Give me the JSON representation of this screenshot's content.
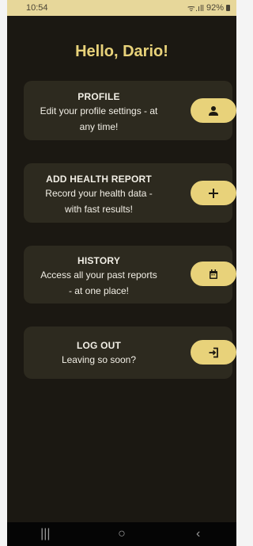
{
  "status_bar": {
    "time": "10:54",
    "signal_text": "ᯤ.ıll",
    "battery": "92%"
  },
  "greeting": "Hello, Dario!",
  "cards": [
    {
      "title": "PROFILE",
      "description_line1": "Edit your profile settings - at",
      "description_line2": "any time!",
      "icon": "person-icon"
    },
    {
      "title": "ADD HEALTH REPORT",
      "description_line1": "Record your health data -",
      "description_line2": "with fast results!",
      "icon": "plus-icon"
    },
    {
      "title": "HISTORY",
      "description_line1": "Access all your past reports",
      "description_line2": "- at one place!",
      "icon": "calendar-icon"
    },
    {
      "title": "LOG OUT",
      "description_line1": "Leaving so soon?",
      "description_line2": "",
      "icon": "logout-icon"
    }
  ],
  "colors": {
    "background": "#1b1812",
    "card": "#2d2a1f",
    "accent": "#e8d27a",
    "status_bar": "#e7d79a"
  },
  "nav": {
    "recent": "|||",
    "home": "○",
    "back": "‹"
  }
}
